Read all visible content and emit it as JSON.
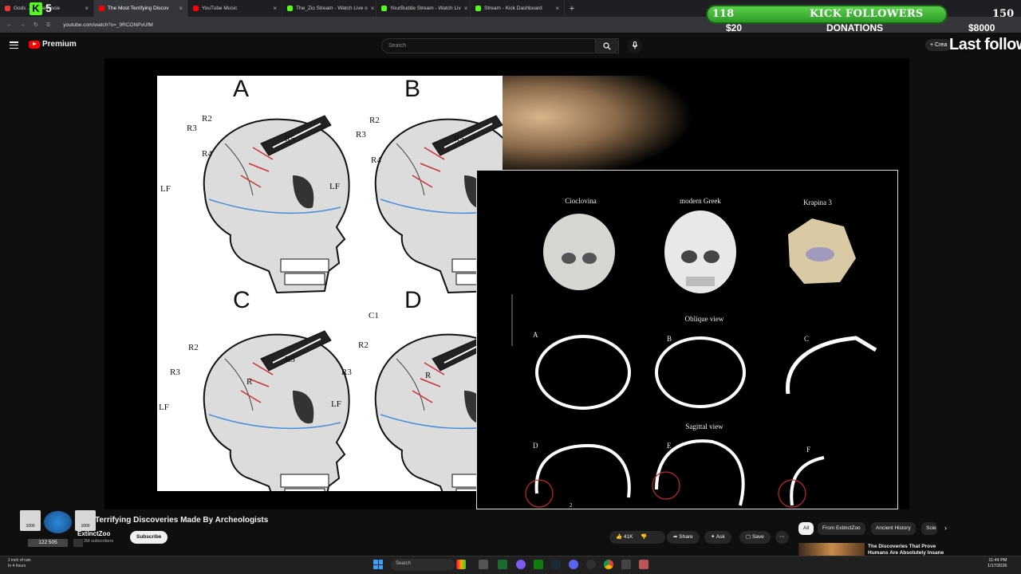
{
  "browser": {
    "tabs": [
      {
        "label": "Gods ... in the Ancie",
        "color": "#e53935",
        "active": false
      },
      {
        "label": "The Most Terrifying Discov",
        "color": "#ff0000",
        "active": true
      },
      {
        "label": "YouTube Music",
        "color": "#ff0000",
        "active": false
      },
      {
        "label": "The_Zio Stream - Watch Live o",
        "color": "#53fc18",
        "active": false
      },
      {
        "label": "YourBudde Stream - Watch Liv",
        "color": "#53fc18",
        "active": false
      },
      {
        "label": "Stream - Kick Dashboard",
        "color": "#53fc18",
        "active": false
      }
    ],
    "url": "youtube.com/watch?v=_9RCONPvUfM"
  },
  "youtube": {
    "logo_text": "Premium",
    "search_placeholder": "Search",
    "create_label": "Crea"
  },
  "overlay": {
    "kick_digit": "5",
    "followers_left": "118",
    "followers_title": "KICK FOLLOWERS",
    "followers_right": "150",
    "donations_left": "$20",
    "donations_title": "DONATIONS",
    "donations_right": "$8000",
    "last_follower": "Last followe",
    "mod_count": "122 505",
    "badges": [
      "1000",
      "1000"
    ]
  },
  "figure": {
    "panel_letters": [
      "A",
      "B",
      "C",
      "D"
    ],
    "labels": {
      "r2": "R2",
      "r3": "R3",
      "r4": "R4",
      "r5": "R5",
      "lf": "LF",
      "r": "R",
      "c1": "C1"
    },
    "inset": {
      "skull_names": [
        "Cioclovina",
        "modern Greek",
        "Krapina 3"
      ],
      "oblique_title": "Oblique view",
      "sagittal_title": "Sagittal view",
      "section_letters": [
        "A",
        "B",
        "C",
        "D",
        "E",
        "F"
      ],
      "stray_digit": "2"
    }
  },
  "video": {
    "title": "Terrifying Discoveries Made By Archeologists",
    "channel": "ExtinctZoo",
    "subscribers": "2M subscribers",
    "subscribe_label": "Subscribe",
    "likes": "41K",
    "share_label": "Share",
    "ask_label": "Ask",
    "save_label": "Save"
  },
  "recommendations": {
    "chips": [
      "All",
      "From ExtinctZoo",
      "Ancient History",
      "Scie"
    ],
    "first_title": "The Discoveries That Prove Humans Are Absolutely Insane"
  },
  "taskbar": {
    "weather_line1": "1 inch of rain",
    "weather_line2": "In 4 hours",
    "search_placeholder": "Search",
    "time": "11:44 PM",
    "date": "1/17/2026"
  }
}
